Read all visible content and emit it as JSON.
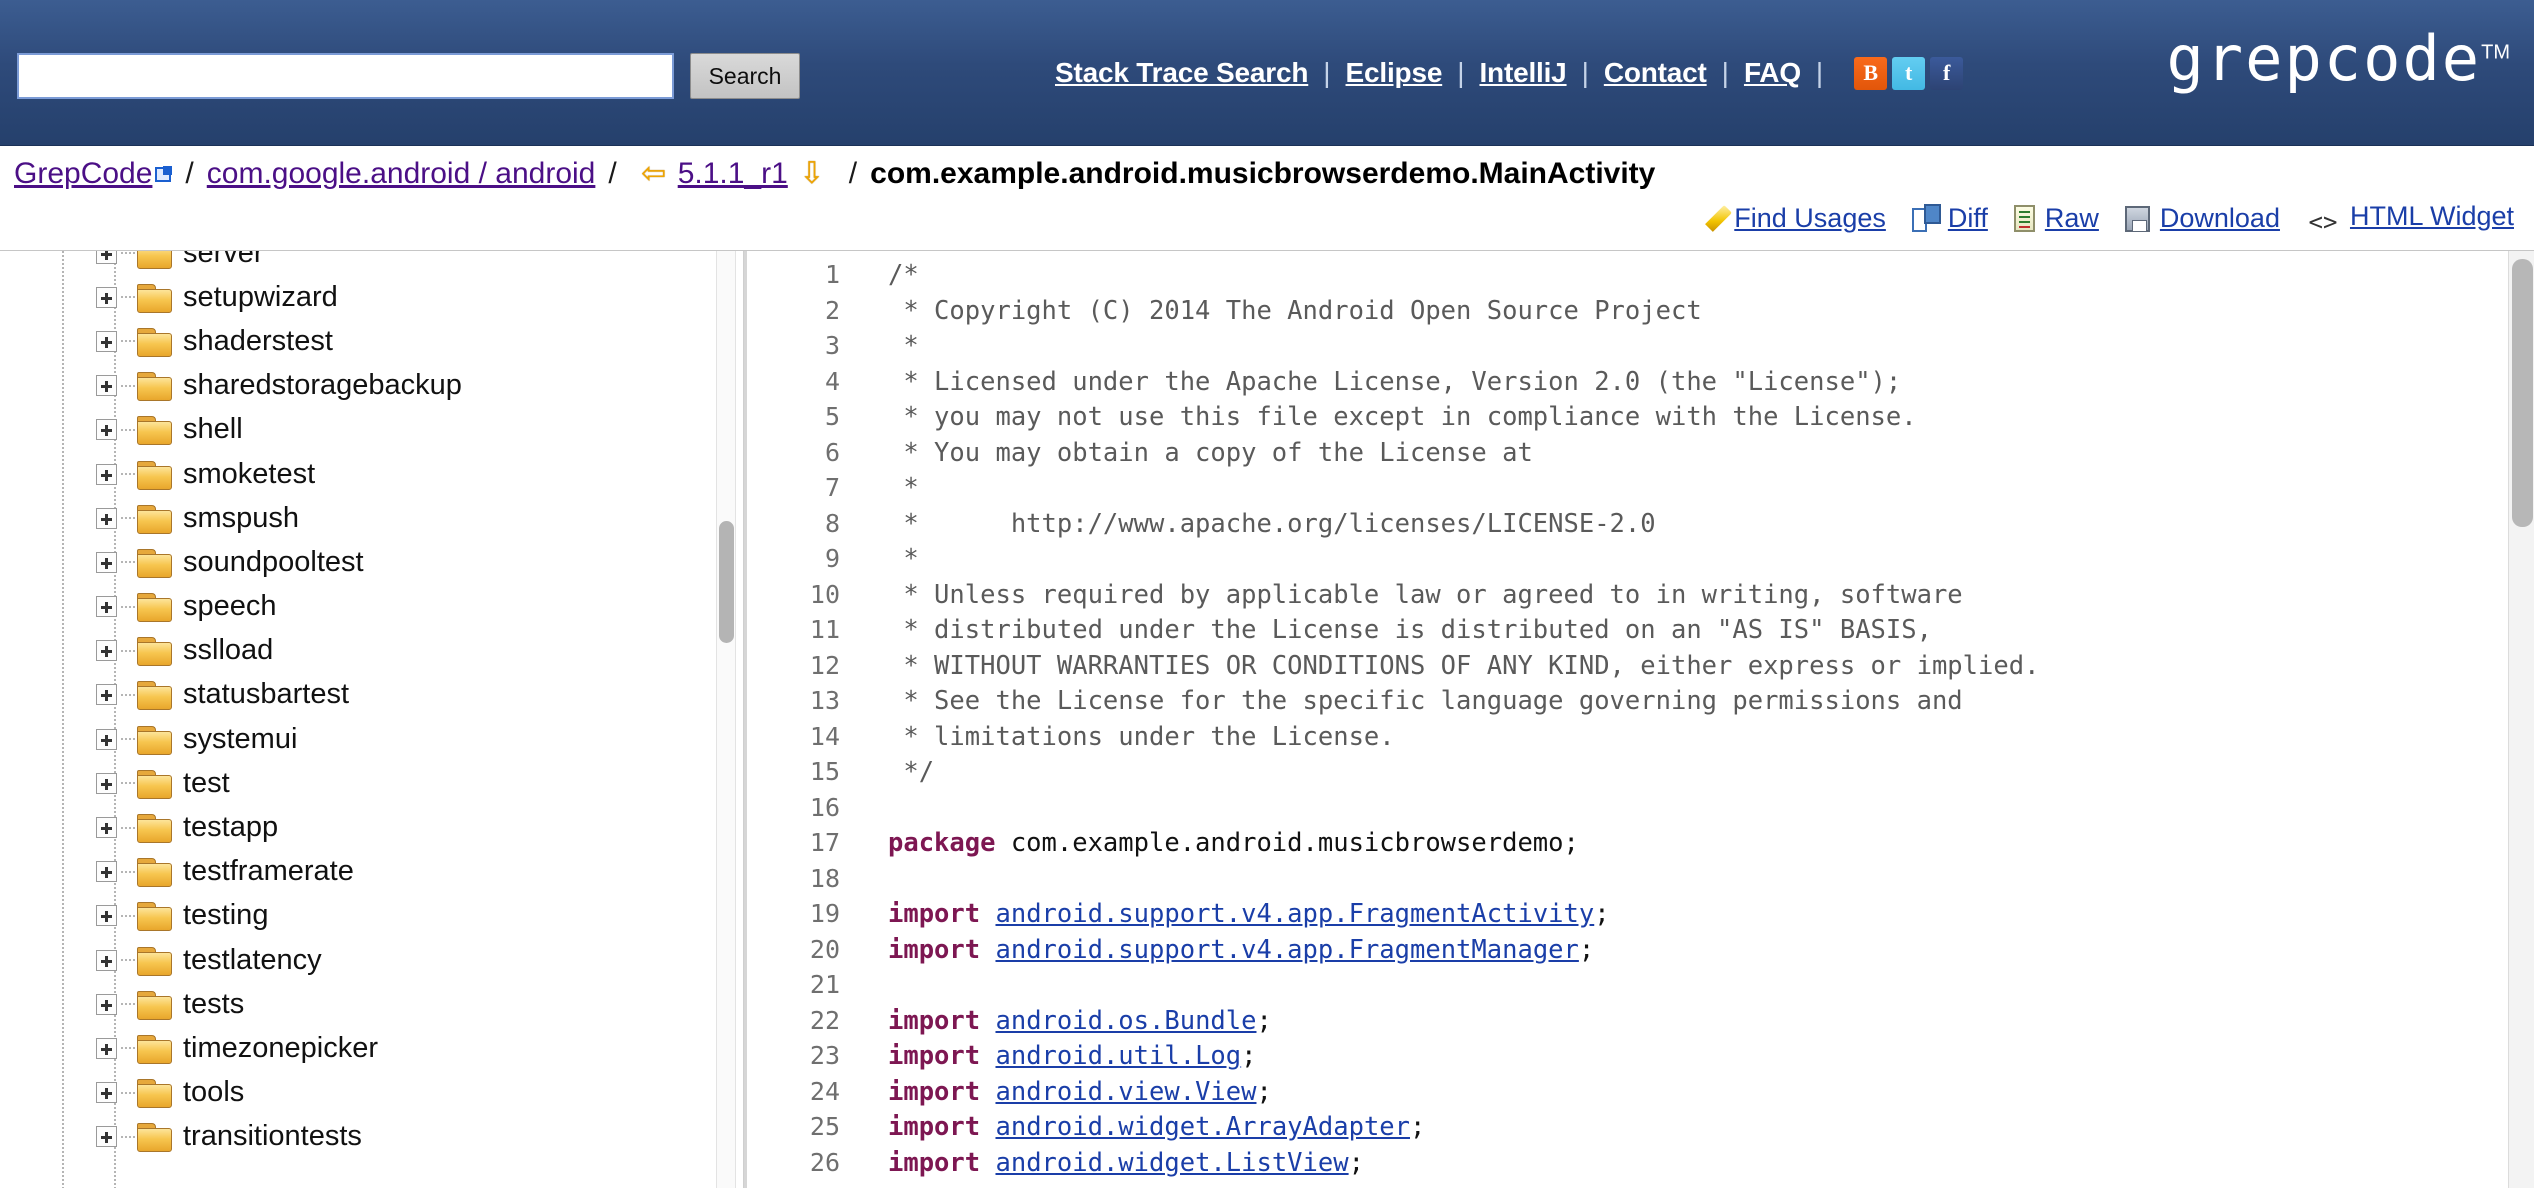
{
  "header": {
    "search": {
      "value": "",
      "placeholder": ""
    },
    "search_button": "Search",
    "nav": [
      {
        "label": "Stack Trace Search"
      },
      {
        "label": "Eclipse"
      },
      {
        "label": "IntelliJ"
      },
      {
        "label": "Contact"
      },
      {
        "label": "FAQ"
      }
    ],
    "separator": "|",
    "social": [
      {
        "name": "blogger-icon",
        "glyph": "B"
      },
      {
        "name": "twitter-icon",
        "glyph": "t"
      },
      {
        "name": "facebook-icon",
        "glyph": "f"
      }
    ],
    "logo": {
      "text": "grepcode",
      "tm": "TM"
    },
    "colors": {
      "bar_top": "#3c5d91",
      "bar_bottom": "#25406c",
      "link": "#ffffff"
    }
  },
  "breadcrumb": {
    "root": "GrepCode",
    "project": "com.google.android / android",
    "version": "5.1.1_r1",
    "current": "com.example.android.musicbrowserdemo.MainActivity",
    "slash": "/",
    "prev_arrow": "⇦",
    "next_arrow": "⇩",
    "colors": {
      "link": "#4b0f86",
      "ext_link": "#1a3ea8",
      "arrow": "#f0a500"
    }
  },
  "toolbar": {
    "items": [
      {
        "icon": "pencil-icon",
        "label": "Find Usages"
      },
      {
        "icon": "diff-icon",
        "label": "Diff"
      },
      {
        "icon": "raw-file-icon",
        "label": "Raw"
      },
      {
        "icon": "floppy-disk-icon",
        "label": "Download"
      },
      {
        "icon": "angle-brackets-icon",
        "label": "HTML Widget"
      }
    ],
    "code_icon_glyph": "<>"
  },
  "sidebar": {
    "tree": [
      {
        "label": "server",
        "partial": true
      },
      {
        "label": "setupwizard"
      },
      {
        "label": "shaderstest"
      },
      {
        "label": "sharedstoragebackup"
      },
      {
        "label": "shell"
      },
      {
        "label": "smoketest"
      },
      {
        "label": "smspush"
      },
      {
        "label": "soundpooltest"
      },
      {
        "label": "speech"
      },
      {
        "label": "sslload"
      },
      {
        "label": "statusbartest"
      },
      {
        "label": "systemui"
      },
      {
        "label": "test"
      },
      {
        "label": "testapp"
      },
      {
        "label": "testframerate"
      },
      {
        "label": "testing"
      },
      {
        "label": "testlatency"
      },
      {
        "label": "tests"
      },
      {
        "label": "timezonepicker"
      },
      {
        "label": "tools"
      },
      {
        "label": "transitiontests"
      }
    ],
    "expander_glyph": "+"
  },
  "code": {
    "lines": [
      {
        "n": "1",
        "parts": [
          {
            "t": "cmt",
            "s": "/*"
          }
        ]
      },
      {
        "n": "2",
        "parts": [
          {
            "t": "cmt",
            "s": " * Copyright (C) 2014 The Android Open Source Project"
          }
        ]
      },
      {
        "n": "3",
        "parts": [
          {
            "t": "cmt",
            "s": " *"
          }
        ]
      },
      {
        "n": "4",
        "parts": [
          {
            "t": "cmt",
            "s": " * Licensed under the Apache License, Version 2.0 (the \"License\");"
          }
        ]
      },
      {
        "n": "5",
        "parts": [
          {
            "t": "cmt",
            "s": " * you may not use this file except in compliance with the License."
          }
        ]
      },
      {
        "n": "6",
        "parts": [
          {
            "t": "cmt",
            "s": " * You may obtain a copy of the License at"
          }
        ]
      },
      {
        "n": "7",
        "parts": [
          {
            "t": "cmt",
            "s": " *"
          }
        ]
      },
      {
        "n": "8",
        "parts": [
          {
            "t": "cmt",
            "s": " *      http://www.apache.org/licenses/LICENSE-2.0"
          }
        ]
      },
      {
        "n": "9",
        "parts": [
          {
            "t": "cmt",
            "s": " *"
          }
        ]
      },
      {
        "n": "10",
        "parts": [
          {
            "t": "cmt",
            "s": " * Unless required by applicable law or agreed to in writing, software"
          }
        ]
      },
      {
        "n": "11",
        "parts": [
          {
            "t": "cmt",
            "s": " * distributed under the License is distributed on an \"AS IS\" BASIS,"
          }
        ]
      },
      {
        "n": "12",
        "parts": [
          {
            "t": "cmt",
            "s": " * WITHOUT WARRANTIES OR CONDITIONS OF ANY KIND, either express or implied."
          }
        ]
      },
      {
        "n": "13",
        "parts": [
          {
            "t": "cmt",
            "s": " * See the License for the specific language governing permissions and"
          }
        ]
      },
      {
        "n": "14",
        "parts": [
          {
            "t": "cmt",
            "s": " * limitations under the License."
          }
        ]
      },
      {
        "n": "15",
        "parts": [
          {
            "t": "cmt",
            "s": " */"
          }
        ]
      },
      {
        "n": "16",
        "parts": []
      },
      {
        "n": "17",
        "parts": [
          {
            "t": "kw",
            "s": "package"
          },
          {
            "t": "pln",
            "s": " com.example.android.musicbrowserdemo;"
          }
        ]
      },
      {
        "n": "18",
        "parts": []
      },
      {
        "n": "19",
        "parts": [
          {
            "t": "kw",
            "s": "import"
          },
          {
            "t": "pln",
            "s": " "
          },
          {
            "t": "lnk",
            "s": "android.support.v4.app.FragmentActivity"
          },
          {
            "t": "pln",
            "s": ";"
          }
        ]
      },
      {
        "n": "20",
        "parts": [
          {
            "t": "kw",
            "s": "import"
          },
          {
            "t": "pln",
            "s": " "
          },
          {
            "t": "lnk",
            "s": "android.support.v4.app.FragmentManager"
          },
          {
            "t": "pln",
            "s": ";"
          }
        ]
      },
      {
        "n": "21",
        "parts": []
      },
      {
        "n": "22",
        "parts": [
          {
            "t": "kw",
            "s": "import"
          },
          {
            "t": "pln",
            "s": " "
          },
          {
            "t": "lnk",
            "s": "android.os.Bundle"
          },
          {
            "t": "pln",
            "s": ";"
          }
        ]
      },
      {
        "n": "23",
        "parts": [
          {
            "t": "kw",
            "s": "import"
          },
          {
            "t": "pln",
            "s": " "
          },
          {
            "t": "lnk",
            "s": "android.util.Log"
          },
          {
            "t": "pln",
            "s": ";"
          }
        ]
      },
      {
        "n": "24",
        "parts": [
          {
            "t": "kw",
            "s": "import"
          },
          {
            "t": "pln",
            "s": " "
          },
          {
            "t": "lnk",
            "s": "android.view.View"
          },
          {
            "t": "pln",
            "s": ";"
          }
        ]
      },
      {
        "n": "25",
        "parts": [
          {
            "t": "kw",
            "s": "import"
          },
          {
            "t": "pln",
            "s": " "
          },
          {
            "t": "lnk",
            "s": "android.widget.ArrayAdapter"
          },
          {
            "t": "pln",
            "s": ";"
          }
        ]
      },
      {
        "n": "26",
        "parts": [
          {
            "t": "kw",
            "s": "import"
          },
          {
            "t": "pln",
            "s": " "
          },
          {
            "t": "lnk",
            "s": "android.widget.ListView"
          },
          {
            "t": "pln",
            "s": ";"
          }
        ]
      }
    ],
    "colors": {
      "comment": "#5a5a5a",
      "keyword": "#7d1752",
      "link": "#1a3ea8",
      "linenum": "#6f6f6f"
    }
  }
}
